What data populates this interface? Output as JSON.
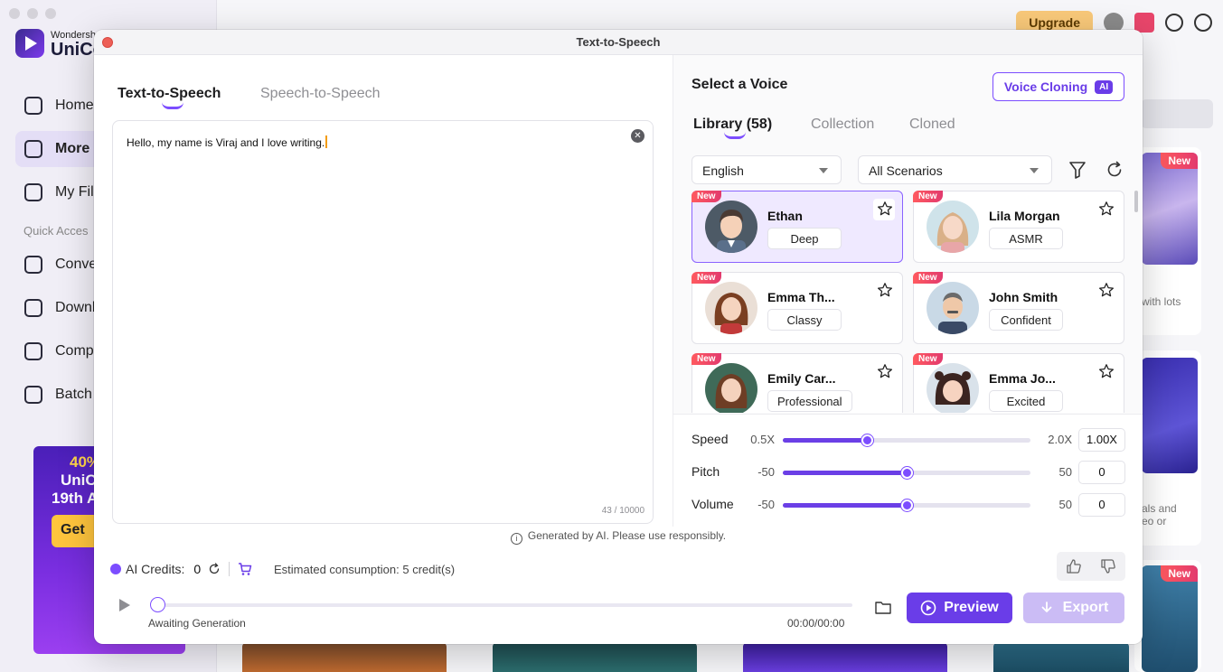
{
  "background": {
    "brand_small": "Wondersh",
    "brand_big": "UniCo",
    "nav": [
      "Home",
      "More",
      "My Fil",
      "Conve",
      "Downl",
      "Comp",
      "Batch"
    ],
    "quick_access": "Quick Acces",
    "promo": {
      "line1": "40%",
      "line2": "UniCo",
      "line3": "19th A",
      "button": "Get"
    },
    "upgrade": "Upgrade",
    "card_texts": [
      "with lots",
      "als and",
      "eo or"
    ],
    "new_label": "New"
  },
  "dialog": {
    "title": "Text-to-Speech",
    "tabs": {
      "active": "Text-to-Speech",
      "inactive": "Speech-to-Speech"
    },
    "editor": {
      "text": "Hello, my name is Viraj and I love writing.",
      "count": "43 / 10000"
    },
    "select_voice": "Select a Voice",
    "voice_cloning": {
      "label": "Voice Cloning",
      "badge": "AI"
    },
    "library_tabs": {
      "library": "Library (58)",
      "collection": "Collection",
      "cloned": "Cloned"
    },
    "filters": {
      "language": "English",
      "scenario": "All Scenarios"
    },
    "new_badge": "New",
    "voices": [
      {
        "name": "Ethan",
        "tag": "Deep",
        "selected": true
      },
      {
        "name": "Lila Morgan",
        "tag": "ASMR",
        "selected": false
      },
      {
        "name": "Emma Th...",
        "tag": "Classy",
        "selected": false
      },
      {
        "name": "John Smith",
        "tag": "Confident",
        "selected": false
      },
      {
        "name": "Emily Car...",
        "tag": "Professional",
        "selected": false
      },
      {
        "name": "Emma Jo...",
        "tag": "Excited",
        "selected": false
      }
    ],
    "sliders": {
      "speed": {
        "label": "Speed",
        "min": "0.5X",
        "max": "2.0X",
        "value": "1.00X",
        "fraction": 0.34
      },
      "pitch": {
        "label": "Pitch",
        "min": "-50",
        "max": "50",
        "value": "0",
        "fraction": 0.5
      },
      "volume": {
        "label": "Volume",
        "min": "-50",
        "max": "50",
        "value": "0",
        "fraction": 0.5
      }
    },
    "ai_note": "Generated by AI. Please use responsibly.",
    "credits": {
      "label": "AI Credits:",
      "value": "0"
    },
    "estimated": "Estimated consumption: 5 credit(s)",
    "player": {
      "status": "Awaiting Generation",
      "time": "00:00/00:00",
      "progress": 0
    },
    "buttons": {
      "preview": "Preview",
      "export": "Export"
    }
  },
  "colors": {
    "accent": "#6a3de8",
    "new_badge": "#e23a6e",
    "close": "#ed5f57"
  }
}
